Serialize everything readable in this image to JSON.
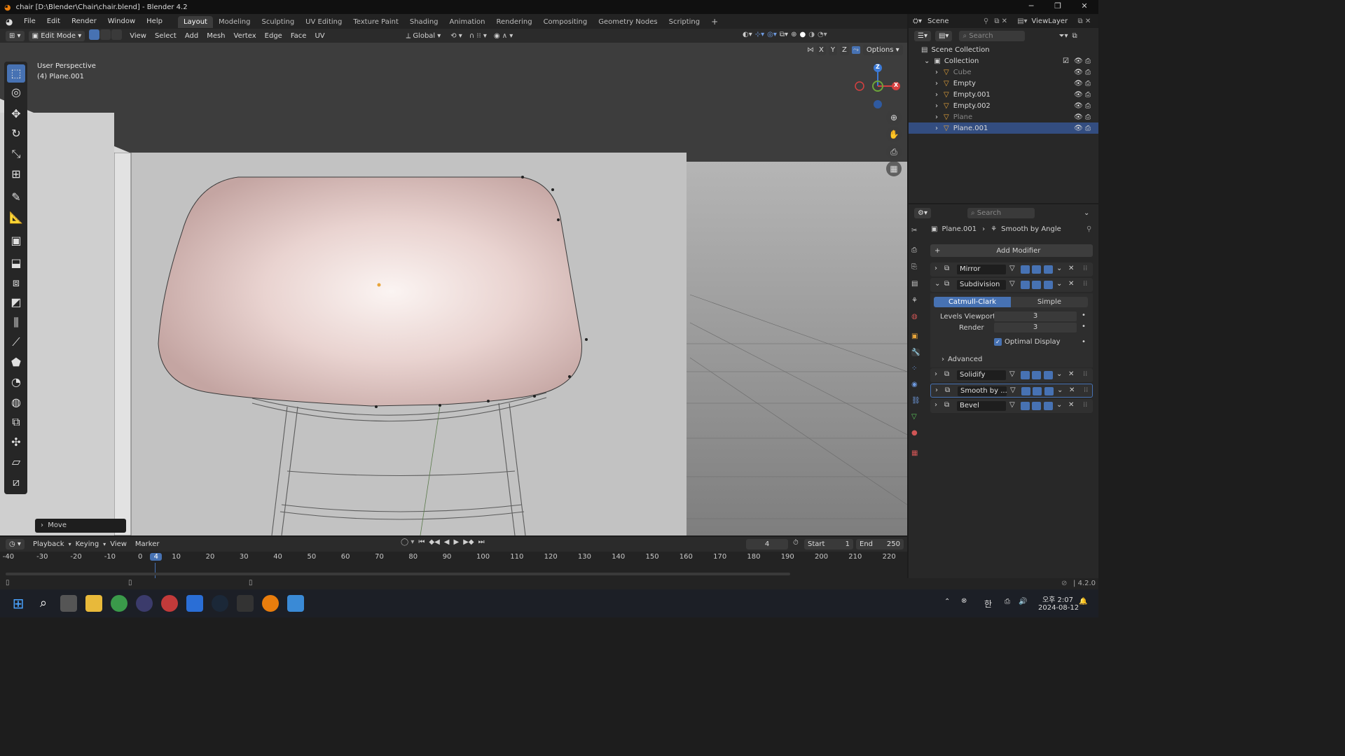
{
  "window": {
    "title": "chair [D:\\Blender\\Chair\\chair.blend] - Blender 4.2",
    "minimize": "─",
    "maximize": "❐",
    "close": "✕"
  },
  "menu": [
    "File",
    "Edit",
    "Render",
    "Window",
    "Help"
  ],
  "workspaces": [
    "Layout",
    "Modeling",
    "Sculpting",
    "UV Editing",
    "Texture Paint",
    "Shading",
    "Animation",
    "Rendering",
    "Compositing",
    "Geometry Nodes",
    "Scripting"
  ],
  "active_workspace": "Layout",
  "add_workspace": "+",
  "scene": {
    "label": "Scene",
    "view_layer": "ViewLayer"
  },
  "header3d": {
    "mode": "Edit Mode",
    "menus": [
      "View",
      "Select",
      "Add",
      "Mesh",
      "Vertex",
      "Edge",
      "Face",
      "UV"
    ],
    "orientation": "Global",
    "options": "Options",
    "axes": [
      "X",
      "Y",
      "Z"
    ]
  },
  "viewport": {
    "perspective": "User Perspective",
    "object": "(4) Plane.001",
    "gizmo": {
      "z": "Z",
      "x": "X"
    },
    "last_op": "Move"
  },
  "outliner": {
    "search_placeholder": "Search",
    "root": "Scene Collection",
    "collection": "Collection",
    "items": [
      {
        "name": "Cube",
        "dim": true
      },
      {
        "name": "Empty",
        "dim": false
      },
      {
        "name": "Empty.001",
        "dim": false
      },
      {
        "name": "Empty.002",
        "dim": false
      },
      {
        "name": "Plane",
        "dim": true
      },
      {
        "name": "Plane.001",
        "dim": false,
        "selected": true
      }
    ]
  },
  "properties": {
    "search_placeholder": "Search",
    "breadcrumb_object": "Plane.001",
    "breadcrumb_modifier": "Smooth by Angle",
    "add_modifier": "Add Modifier",
    "modifiers": [
      {
        "name": "Mirror",
        "expanded": false
      },
      {
        "name": "Subdivision",
        "expanded": true
      },
      {
        "name": "Solidify",
        "expanded": false
      },
      {
        "name": "Smooth by ...",
        "expanded": false,
        "active": true
      },
      {
        "name": "Bevel",
        "expanded": false
      }
    ],
    "subdivision": {
      "type_a": "Catmull-Clark",
      "type_b": "Simple",
      "levels_viewport_label": "Levels Viewport",
      "levels_viewport": "3",
      "render_label": "Render",
      "render": "3",
      "optimal_display": "Optimal Display",
      "advanced": "Advanced"
    }
  },
  "timeline": {
    "menus": [
      "Playback",
      "Keying",
      "View",
      "Marker"
    ],
    "current_frame": "4",
    "start_label": "Start",
    "start": "1",
    "end_label": "End",
    "end": "250",
    "ruler": [
      "-40",
      "-30",
      "-20",
      "-10",
      "0",
      "4",
      "10",
      "20",
      "30",
      "40",
      "50",
      "60",
      "70",
      "80",
      "90",
      "100",
      "110",
      "120",
      "130",
      "140",
      "150",
      "160",
      "170",
      "180",
      "190",
      "200",
      "210",
      "220"
    ]
  },
  "statusbar": {
    "version": "4.2.0"
  },
  "taskbar": {
    "clock_ampm": "오후 2:07",
    "date": "2024-08-12",
    "ime": "한"
  },
  "colors": {
    "accent": "#4772b3",
    "viewport_bg": "#3d3d3d",
    "panel_bg": "#282828"
  }
}
